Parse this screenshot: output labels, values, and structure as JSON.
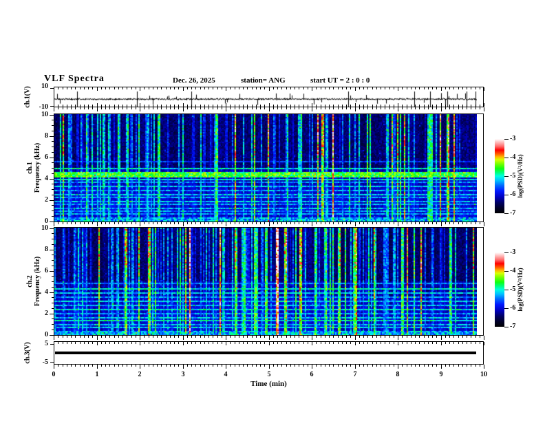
{
  "header": {
    "title": "VLF Spectra",
    "date": "Dec. 26, 2025",
    "station": "station= ANG",
    "start_ut": "start UT =  2 : 0 : 0"
  },
  "axes": {
    "time_label": "Time (min)",
    "time_ticks": [
      0,
      1,
      2,
      3,
      4,
      5,
      6,
      7,
      8,
      9,
      10
    ],
    "time_minor_step": 0.1,
    "time_range_min": [
      0,
      10
    ],
    "data_end_min": 9.84,
    "freq_ticks_khz": [
      0,
      2,
      4,
      6,
      8,
      10
    ],
    "freq_minor_step_khz": 0.5
  },
  "colorbar": {
    "label": "log(PSD)(V²/Hz)",
    "ticks": [
      -3,
      -4,
      -5,
      -6,
      -7
    ],
    "range": [
      -7,
      -3
    ],
    "stops": [
      {
        "v": 0.0,
        "c": "#000000"
      },
      {
        "v": 0.07,
        "c": "#000028"
      },
      {
        "v": 0.14,
        "c": "#000060"
      },
      {
        "v": 0.22,
        "c": "#0000c0"
      },
      {
        "v": 0.3,
        "c": "#0018ff"
      },
      {
        "v": 0.38,
        "c": "#0070ff"
      },
      {
        "v": 0.44,
        "c": "#00c0ff"
      },
      {
        "v": 0.5,
        "c": "#00ffe0"
      },
      {
        "v": 0.55,
        "c": "#00ff78"
      },
      {
        "v": 0.6,
        "c": "#10ff10"
      },
      {
        "v": 0.66,
        "c": "#70ff00"
      },
      {
        "v": 0.72,
        "c": "#d8ff00"
      },
      {
        "v": 0.76,
        "c": "#ffb400"
      },
      {
        "v": 0.8,
        "c": "#ff5a00"
      },
      {
        "v": 0.85,
        "c": "#ff0000"
      },
      {
        "v": 0.9,
        "c": "#ff6a6a"
      },
      {
        "v": 0.95,
        "c": "#ffb4b4"
      },
      {
        "v": 1.0,
        "c": "#ffffff"
      }
    ]
  },
  "chart_data": [
    {
      "type": "line",
      "id": "ch1_voltage",
      "axis_label": "ch.1(V)",
      "ylim": [
        -10,
        10
      ],
      "yticks": [
        10,
        -10
      ],
      "xlim_min": [
        0,
        10
      ],
      "description": "Noisy broadband voltage trace centered slightly below 0 V with impulsive sferic spikes up to about +/-10 V",
      "gen": {
        "seed": 11,
        "noise_v": 1.5,
        "n_spikes": 30,
        "spike_v_min": 3,
        "spike_v_max": 8,
        "n_full_clips": 9
      }
    },
    {
      "type": "heatmap",
      "id": "ch1_spectrogram",
      "channel": "ch.1",
      "axis_label": "Frequency (kHz)",
      "ylim_khz": [
        0,
        10
      ],
      "xlim_min": [
        0,
        10
      ],
      "value_label": "log(PSD)(V²/Hz)",
      "value_range": [
        -7,
        -3
      ],
      "description": "VLF spectrogram: dark blue background, dense vertical sferic streaks (cyan/green, some red), bright horizontal band near 4.2-4.6 kHz and harmonic lines below 4 kHz",
      "gen": {
        "seed": 42,
        "streak_density": 0.44,
        "band": {
          "f0": 4.15,
          "f1": 4.6,
          "a": 0.62
        },
        "hlines": [
          [
            4.95,
            0.06,
            0.5
          ],
          [
            5.6,
            0.06,
            0.34
          ],
          [
            3.95,
            0.06,
            0.48
          ],
          [
            3.6,
            0.06,
            0.4
          ],
          [
            3.25,
            0.06,
            0.45
          ],
          [
            2.9,
            0.06,
            0.42
          ],
          [
            2.55,
            0.06,
            0.46
          ],
          [
            2.2,
            0.06,
            0.42
          ],
          [
            1.9,
            0.06,
            0.45
          ],
          [
            1.55,
            0.06,
            0.42
          ],
          [
            1.25,
            0.06,
            0.44
          ],
          [
            0.95,
            0.06,
            0.4
          ],
          [
            0.65,
            0.06,
            0.42
          ]
        ]
      }
    },
    {
      "type": "heatmap",
      "id": "ch2_spectrogram",
      "channel": "ch.2",
      "axis_label": "Frequency (kHz)",
      "ylim_khz": [
        0,
        10
      ],
      "xlim_min": [
        0,
        10
      ],
      "value_label": "log(PSD)(V²/Hz)",
      "value_range": [
        -7,
        -3
      ],
      "description": "Second channel VLF spectrogram: similar vertical sferic streaks with green/cyan harmonic lines below 5 kHz, no single dominant band",
      "gen": {
        "seed": 1337,
        "streak_density": 0.46,
        "band": null,
        "hlines": [
          [
            4.75,
            0.06,
            0.4
          ],
          [
            4.3,
            0.07,
            0.5
          ],
          [
            3.9,
            0.06,
            0.46
          ],
          [
            3.5,
            0.06,
            0.42
          ],
          [
            3.1,
            0.06,
            0.46
          ],
          [
            2.7,
            0.06,
            0.44
          ],
          [
            2.35,
            0.07,
            0.5
          ],
          [
            2.0,
            0.06,
            0.42
          ],
          [
            1.65,
            0.06,
            0.46
          ],
          [
            1.35,
            0.08,
            0.52
          ],
          [
            1.0,
            0.06,
            0.44
          ],
          [
            0.7,
            0.06,
            0.46
          ]
        ]
      }
    },
    {
      "type": "line",
      "id": "ch3_voltage",
      "axis_label": "ch.3(V)",
      "ylim": [
        -5,
        5
      ],
      "yticks": [
        5,
        -5
      ],
      "xlim_min": [
        0,
        10
      ],
      "value": 0,
      "description": "Flat thick trace at 0 V for full record length"
    }
  ]
}
